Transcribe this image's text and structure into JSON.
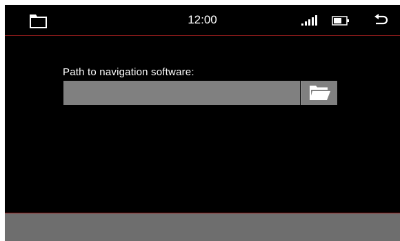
{
  "status_bar": {
    "time": "12:00",
    "icons": {
      "left": "folder-icon",
      "signal": "signal-strength-icon",
      "battery": "battery-icon",
      "back": "back-arrow-icon"
    }
  },
  "main": {
    "path_label": "Path to navigation software:",
    "path_value": "",
    "browse_icon": "open-folder-icon"
  },
  "colors": {
    "background": "#000000",
    "accent": "#a01c1c",
    "input": "#808080",
    "footer": "#6e6e6e",
    "text": "#ffffff"
  }
}
